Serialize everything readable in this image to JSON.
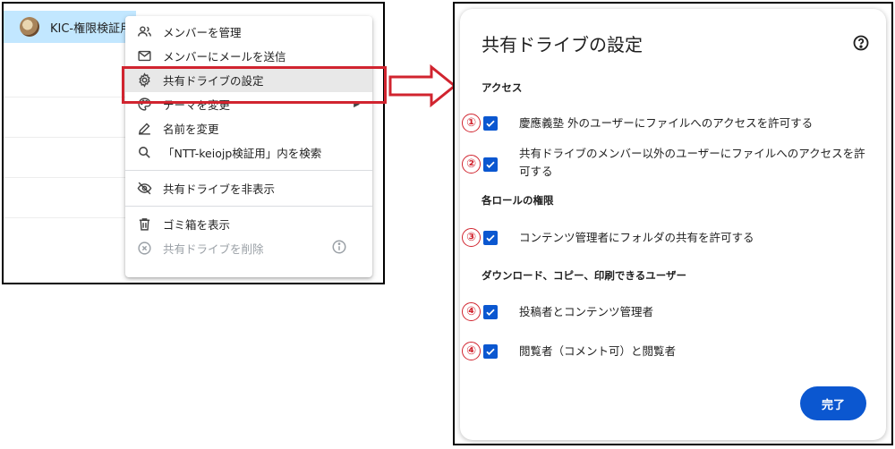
{
  "left": {
    "drive_name": "KIC-権限検証用",
    "menu": [
      {
        "label": "メンバーを管理",
        "icon": "people-icon",
        "state": "normal"
      },
      {
        "label": "メンバーにメールを送信",
        "icon": "mail-icon",
        "state": "normal"
      },
      {
        "label": "共有ドライブの設定",
        "icon": "gear-icon",
        "state": "active"
      },
      {
        "label": "テーマを変更",
        "icon": "palette-icon",
        "state": "normal",
        "submenu": true
      },
      {
        "label": "名前を変更",
        "icon": "pencil-icon",
        "state": "normal"
      },
      {
        "label": "「NTT-keiojp検証用」内を検索",
        "icon": "search-icon",
        "state": "normal"
      },
      {
        "label": "共有ドライブを非表示",
        "icon": "eye-off-icon",
        "state": "normal"
      },
      {
        "label": "ゴミ箱を表示",
        "icon": "trash-icon",
        "state": "normal"
      },
      {
        "label": "共有ドライブを削除",
        "icon": "close-circle-icon",
        "state": "disabled",
        "info": true
      }
    ]
  },
  "dialog": {
    "title": "共有ドライブの設定",
    "sections": [
      {
        "title": "アクセス"
      },
      {
        "title": "各ロールの権限"
      },
      {
        "title": "ダウンロード、コピー、印刷できるユーザー"
      }
    ],
    "options": [
      {
        "badge": "①",
        "label": "慶應義塾 外のユーザーにファイルへのアクセスを許可する",
        "checked": true
      },
      {
        "badge": "②",
        "label": "共有ドライブのメンバー以外のユーザーにファイルへのアクセスを許可する",
        "checked": true
      },
      {
        "badge": "③",
        "label": "コンテンツ管理者にフォルダの共有を許可する",
        "checked": true
      },
      {
        "badge": "④",
        "label": "投稿者とコンテンツ管理者",
        "checked": true
      },
      {
        "badge": "④",
        "label": "閲覧者（コメント可）と閲覧者",
        "checked": true
      }
    ],
    "done_label": "完了"
  },
  "colors": {
    "accent": "#0b57d0",
    "highlight": "#d1242f",
    "selected_row": "#c2e7ff"
  }
}
